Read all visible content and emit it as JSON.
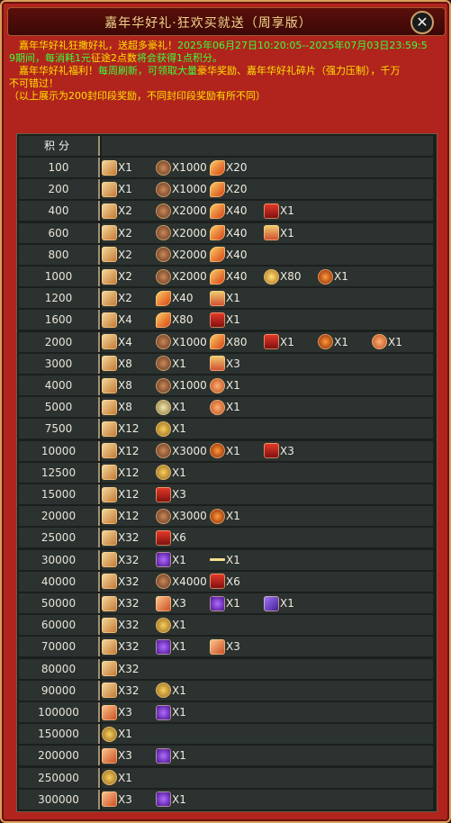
{
  "window": {
    "title": "嘉年华好礼·狂欢买就送（周享版）",
    "close_glyph": "✕"
  },
  "notice": {
    "line1_a": "　嘉年华好礼狂撒好礼，送超多豪礼！",
    "line1_b": "2025年06月27日10:20:05--2025年07月03日23:59:5",
    "line2_a": "9期间，每消耗1元",
    "line2_b": "征途2点数",
    "line2_c": "将会获得1点积分。",
    "line3_a": "　嘉年华好礼福利！",
    "line3_b": "每周刷新，可领取大量",
    "line3_c": "豪华奖励、嘉年华好礼碎片（强力压制），千万",
    "line4": "不可错过！",
    "line5": "（以上展示为200封印段奖励，不同封印段奖励有所不同）"
  },
  "table": {
    "header": "积分",
    "rows": [
      {
        "points": "100",
        "items": [
          {
            "icon": "scroll-icon",
            "qty": "X1"
          },
          {
            "icon": "ore-icon",
            "qty": "X1000"
          },
          {
            "icon": "feather-icon",
            "qty": "X20"
          }
        ]
      },
      {
        "points": "200",
        "items": [
          {
            "icon": "scroll-icon",
            "qty": "X1"
          },
          {
            "icon": "ore-icon",
            "qty": "X1000"
          },
          {
            "icon": "feather-icon",
            "qty": "X20"
          }
        ]
      },
      {
        "points": "400",
        "items": [
          {
            "icon": "scroll-icon",
            "qty": "X2"
          },
          {
            "icon": "ore-icon",
            "qty": "X2000"
          },
          {
            "icon": "feather-icon",
            "qty": "X40"
          },
          {
            "icon": "red-gift-icon",
            "qty": "X1"
          }
        ]
      },
      {
        "points": "600",
        "items": [
          {
            "icon": "scroll-icon",
            "qty": "X2"
          },
          {
            "icon": "ore-icon",
            "qty": "X2000"
          },
          {
            "icon": "feather-icon",
            "qty": "X40"
          },
          {
            "icon": "gift-box-icon",
            "qty": "X1"
          }
        ]
      },
      {
        "points": "800",
        "items": [
          {
            "icon": "scroll-icon",
            "qty": "X2"
          },
          {
            "icon": "ore-icon",
            "qty": "X2000"
          },
          {
            "icon": "feather-icon",
            "qty": "X40"
          }
        ]
      },
      {
        "points": "1000",
        "items": [
          {
            "icon": "scroll-icon",
            "qty": "X2"
          },
          {
            "icon": "ore-icon",
            "qty": "X2000"
          },
          {
            "icon": "feather-icon",
            "qty": "X40"
          },
          {
            "icon": "gold-orb-icon",
            "qty": "X80"
          },
          {
            "icon": "fire-orb-icon",
            "qty": "X1"
          }
        ]
      },
      {
        "points": "1200",
        "items": [
          {
            "icon": "scroll-icon",
            "qty": "X2"
          },
          {
            "icon": "feather-icon",
            "qty": "X40"
          },
          {
            "icon": "gift-box-icon",
            "qty": "X1"
          }
        ]
      },
      {
        "points": "1600",
        "items": [
          {
            "icon": "scroll-icon",
            "qty": "X4"
          },
          {
            "icon": "feather-icon",
            "qty": "X80"
          },
          {
            "icon": "red-gift-icon",
            "qty": "X1"
          }
        ]
      },
      {
        "points": "2000",
        "items": [
          {
            "icon": "scroll-icon",
            "qty": "X4"
          },
          {
            "icon": "ore-icon",
            "qty": "X1000"
          },
          {
            "icon": "feather-icon",
            "qty": "X80"
          },
          {
            "icon": "red-gift-icon",
            "qty": "X1"
          },
          {
            "icon": "fire-orb-icon",
            "qty": "X1"
          },
          {
            "icon": "burst-icon",
            "qty": "X1"
          }
        ]
      },
      {
        "points": "3000",
        "items": [
          {
            "icon": "scroll-icon",
            "qty": "X8"
          },
          {
            "icon": "ore-icon",
            "qty": "X1"
          },
          {
            "icon": "gift-box-icon",
            "qty": "X3"
          }
        ]
      },
      {
        "points": "4000",
        "items": [
          {
            "icon": "scroll-icon",
            "qty": "X8"
          },
          {
            "icon": "ore-icon",
            "qty": "X1000"
          },
          {
            "icon": "burst-icon",
            "qty": "X1"
          }
        ]
      },
      {
        "points": "5000",
        "items": [
          {
            "icon": "scroll-icon",
            "qty": "X8"
          },
          {
            "icon": "token-icon",
            "qty": "X1"
          },
          {
            "icon": "burst-icon",
            "qty": "X1"
          }
        ]
      },
      {
        "points": "7500",
        "items": [
          {
            "icon": "scroll-icon",
            "qty": "X12"
          },
          {
            "icon": "coin-icon",
            "qty": "X1"
          }
        ]
      },
      {
        "points": "10000",
        "items": [
          {
            "icon": "scroll-icon",
            "qty": "X12"
          },
          {
            "icon": "ore-icon",
            "qty": "X3000"
          },
          {
            "icon": "fire-orb-icon",
            "qty": "X1"
          },
          {
            "icon": "red-gift-icon",
            "qty": "X3"
          }
        ]
      },
      {
        "points": "12500",
        "items": [
          {
            "icon": "scroll-icon",
            "qty": "X12"
          },
          {
            "icon": "coin-icon",
            "qty": "X1"
          }
        ]
      },
      {
        "points": "15000",
        "items": [
          {
            "icon": "scroll-icon",
            "qty": "X12"
          },
          {
            "icon": "red-gift-icon",
            "qty": "X3"
          }
        ]
      },
      {
        "points": "20000",
        "items": [
          {
            "icon": "scroll-icon",
            "qty": "X12"
          },
          {
            "icon": "ore-icon",
            "qty": "X3000"
          },
          {
            "icon": "fire-orb-icon",
            "qty": "X1"
          }
        ]
      },
      {
        "points": "25000",
        "items": [
          {
            "icon": "scroll-icon",
            "qty": "X32"
          },
          {
            "icon": "red-gift-icon",
            "qty": "X6"
          }
        ]
      },
      {
        "points": "30000",
        "items": [
          {
            "icon": "scroll-icon",
            "qty": "X32"
          },
          {
            "icon": "gem-icon",
            "qty": "X1"
          },
          {
            "icon": "rod-icon",
            "qty": "X1"
          }
        ]
      },
      {
        "points": "40000",
        "items": [
          {
            "icon": "scroll-icon",
            "qty": "X32"
          },
          {
            "icon": "ore-icon",
            "qty": "X4000"
          },
          {
            "icon": "red-gift-icon",
            "qty": "X6"
          }
        ]
      },
      {
        "points": "50000",
        "items": [
          {
            "icon": "scroll-icon",
            "qty": "X32"
          },
          {
            "icon": "card-icon",
            "qty": "X3"
          },
          {
            "icon": "gem-icon",
            "qty": "X1"
          },
          {
            "icon": "purple-icon",
            "qty": "X1"
          }
        ]
      },
      {
        "points": "60000",
        "items": [
          {
            "icon": "scroll-icon",
            "qty": "X32"
          },
          {
            "icon": "coin-icon",
            "qty": "X1"
          }
        ]
      },
      {
        "points": "70000",
        "items": [
          {
            "icon": "scroll-icon",
            "qty": "X32"
          },
          {
            "icon": "gem-icon",
            "qty": "X1"
          },
          {
            "icon": "card-icon",
            "qty": "X3"
          }
        ]
      },
      {
        "points": "80000",
        "items": [
          {
            "icon": "scroll-icon",
            "qty": "X32"
          }
        ]
      },
      {
        "points": "90000",
        "items": [
          {
            "icon": "scroll-icon",
            "qty": "X32"
          },
          {
            "icon": "coin-icon",
            "qty": "X1"
          }
        ]
      },
      {
        "points": "100000",
        "items": [
          {
            "icon": "card-icon",
            "qty": "X3"
          },
          {
            "icon": "gem-icon",
            "qty": "X1"
          }
        ]
      },
      {
        "points": "150000",
        "items": [
          {
            "icon": "coin-icon",
            "qty": "X1"
          }
        ]
      },
      {
        "points": "200000",
        "items": [
          {
            "icon": "card-icon",
            "qty": "X3"
          },
          {
            "icon": "gem-icon",
            "qty": "X1"
          }
        ]
      },
      {
        "points": "250000",
        "items": [
          {
            "icon": "coin-icon",
            "qty": "X1"
          }
        ]
      },
      {
        "points": "300000",
        "items": [
          {
            "icon": "card-icon",
            "qty": "X3"
          },
          {
            "icon": "gem-icon",
            "qty": "X1"
          }
        ]
      }
    ]
  }
}
